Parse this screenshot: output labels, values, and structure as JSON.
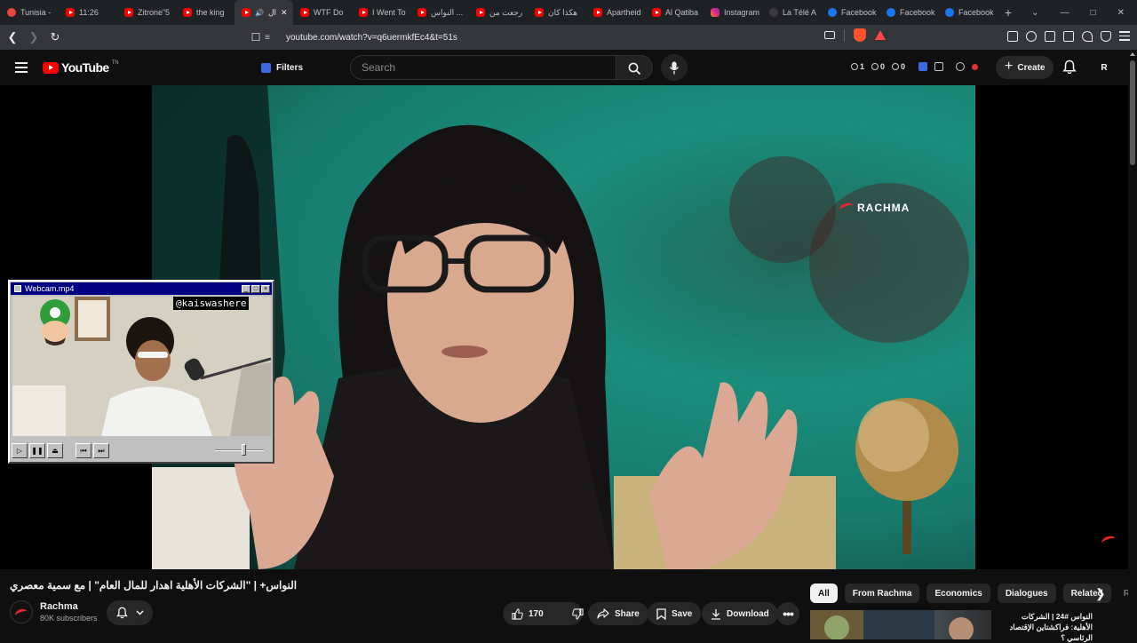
{
  "browser": {
    "tabs": [
      {
        "title": "Tunisia -",
        "icon": "tn"
      },
      {
        "title": "11:26",
        "icon": "yt"
      },
      {
        "title": "Zitrone”5",
        "icon": "yt"
      },
      {
        "title": "the king",
        "icon": "yt"
      },
      {
        "title": "ال",
        "icon": "yt",
        "active": true
      },
      {
        "title": "WTF Do",
        "icon": "yt"
      },
      {
        "title": "I Went To",
        "icon": "yt"
      },
      {
        "title": "النواس ...",
        "icon": "yt"
      },
      {
        "title": "رجعت من",
        "icon": "yt"
      },
      {
        "title": "هكذا كان",
        "icon": "yt"
      },
      {
        "title": "Apartheid",
        "icon": "yt"
      },
      {
        "title": "Al Qatiba",
        "icon": "yt"
      },
      {
        "title": "Instagram",
        "icon": "ig"
      },
      {
        "title": "La Télé A",
        "icon": "tv"
      },
      {
        "title": "Facebook",
        "icon": "fb"
      },
      {
        "title": "Facebook",
        "icon": "fb"
      },
      {
        "title": "Facebook",
        "icon": "fb"
      }
    ],
    "new_tab": "+",
    "url": "youtube.com/watch?v=q6uermkfEc4&t=51s"
  },
  "masthead": {
    "logo_text": "YouTube",
    "logo_tn": "TN",
    "filters_label": "Filters",
    "search_placeholder": "Search",
    "stats": [
      "1",
      "0",
      "0"
    ],
    "create_label": "Create",
    "avatar_letter": "R"
  },
  "video": {
    "watermark": "RACHMA"
  },
  "webcam": {
    "title": "Webcam.mp4",
    "handle": "@kaiswashere",
    "volume_level": 0.6
  },
  "meta": {
    "title": "النواس+ | \"الشركات الأهلية اهدار للمال العام\" | مع سمية معصري",
    "channel_name": "Rachma",
    "subscribers": "80K subscribers",
    "likes": "170",
    "share_label": "Share",
    "save_label": "Save",
    "download_label": "Download"
  },
  "chips": [
    "All",
    "From Rachma",
    "Economics",
    "Dialogues",
    "Related",
    "R"
  ],
  "recommended": {
    "title": "النواس #24 | الشركات الأهلية: فراكشتاين الإقتصاد الرئاسي ؟"
  },
  "colors": {
    "accent_red": "#ff0000",
    "brand_red": "#e3252a",
    "bg": "#0f0f0f",
    "win_titlebar": "#000080"
  }
}
